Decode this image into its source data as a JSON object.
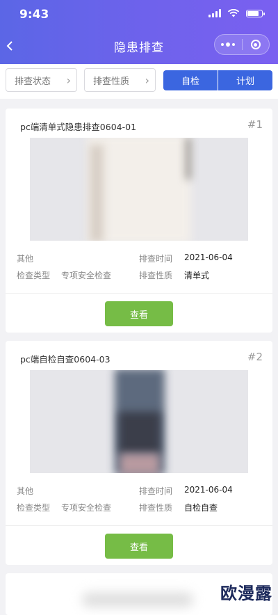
{
  "status_bar": {
    "time": "9:43"
  },
  "navbar": {
    "title": "隐患排查",
    "back_icon": "chevron-left-icon",
    "menu_icon": "more-dots-icon",
    "close_icon": "target-icon"
  },
  "filters": {
    "status_label": "排查状态",
    "nature_label": "排查性质",
    "tab_self": "自检",
    "tab_plan": "计划"
  },
  "colors": {
    "header_start": "#5b66e6",
    "header_end": "#7a60f0",
    "accent_blue": "#3b66e0",
    "button_green": "#76bc46"
  },
  "cards": [
    {
      "title": "pc端清单式隐患排查0604-01",
      "index": "#1",
      "category": "其他",
      "time_label": "排查时间",
      "time_value": "2021-06-04",
      "type_label": "检查类型",
      "type_value": "专项安全检查",
      "nature_label": "排查性质",
      "nature_value": "清单式",
      "button": "查看"
    },
    {
      "title": "pc端自检自查0604-03",
      "index": "#2",
      "category": "其他",
      "time_label": "排查时间",
      "time_value": "2021-06-04",
      "type_label": "检查类型",
      "type_value": "专项安全检查",
      "nature_label": "排查性质",
      "nature_value": "自检自查",
      "button": "查看"
    }
  ],
  "watermark": "欧漫露"
}
